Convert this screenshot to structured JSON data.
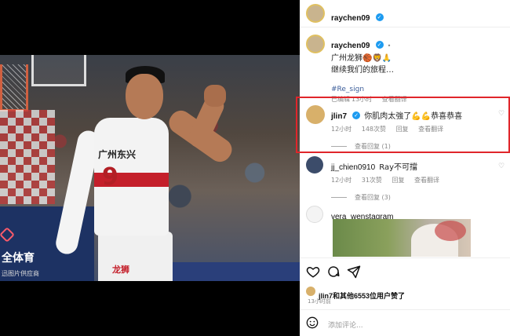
{
  "media": {
    "jersey_number": "9",
    "team_text": "广州东兴",
    "shorts_text": "龙狮",
    "watermark_brand": "全体育",
    "watermark_sub": "迅图片供应商"
  },
  "header": {
    "username": "raychen09"
  },
  "caption": {
    "username": "raychen09",
    "suffix": "•",
    "line1": "广州龙狮🏀🦁🙏",
    "line2": "继续我们的旅程…",
    "hashtag": "#Re_sign",
    "edited": "已编辑",
    "time": "13小时",
    "translate": "查看翻译"
  },
  "comments": [
    {
      "username": "jlin7",
      "text": "你肌肉太強了💪💪恭喜恭喜",
      "time": "12小时",
      "likes": "148次赞",
      "reply": "回复",
      "translate": "查看翻译",
      "view_replies": "查看回复 (1)"
    },
    {
      "username": "jj_chien0910",
      "text": "Ray不可擋",
      "time": "12小时",
      "likes": "31次赞",
      "reply": "回复",
      "translate": "查看翻译",
      "view_replies": "查看回复 (3)"
    },
    {
      "username": "vera_wenstagram"
    }
  ],
  "footer": {
    "liked_by_user": "jlin7",
    "liked_by_rest": "和其他6553位用户赞了",
    "time": "13小时前",
    "input_placeholder": "添加评论..."
  },
  "colors": {
    "highlight_border": "#e0262b",
    "verified": "#1d9bf0",
    "hashtag": "#3a5c99"
  },
  "icons": [
    "verified-badge",
    "heart-icon",
    "comment-icon",
    "share-icon",
    "emoji-icon"
  ]
}
